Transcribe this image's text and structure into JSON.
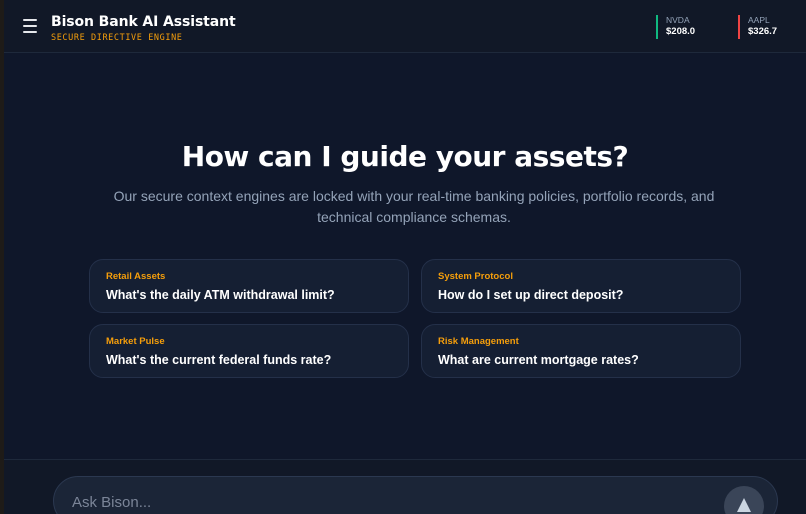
{
  "header": {
    "title": "Bison Bank AI Assistant",
    "subtitle": "SECURE DIRECTIVE ENGINE",
    "menu_icon": "hamburger-icon",
    "tickers": [
      {
        "symbol": "NVDA",
        "price": "$208.0",
        "color": "#10b981"
      },
      {
        "symbol": "AAPL",
        "price": "$326.7",
        "color": "#ef4444"
      }
    ]
  },
  "hero": {
    "title": "How can I guide your assets?",
    "subtitle": "Our secure context engines are locked with your real-time banking policies, portfolio records, and technical compliance schemas."
  },
  "suggestions": [
    {
      "category": "Retail Assets",
      "question": "What's the daily ATM withdrawal limit?"
    },
    {
      "category": "System Protocol",
      "question": "How do I set up direct deposit?"
    },
    {
      "category": "Market Pulse",
      "question": "What's the current federal funds rate?"
    },
    {
      "category": "Risk Management",
      "question": "What are current mortgage rates?"
    }
  ],
  "composer": {
    "placeholder": "Ask Bison...",
    "send_icon": "send-arrow-icon"
  },
  "colors": {
    "accent": "#f59e0b",
    "background": "#0f172a",
    "card": "#151f33"
  }
}
